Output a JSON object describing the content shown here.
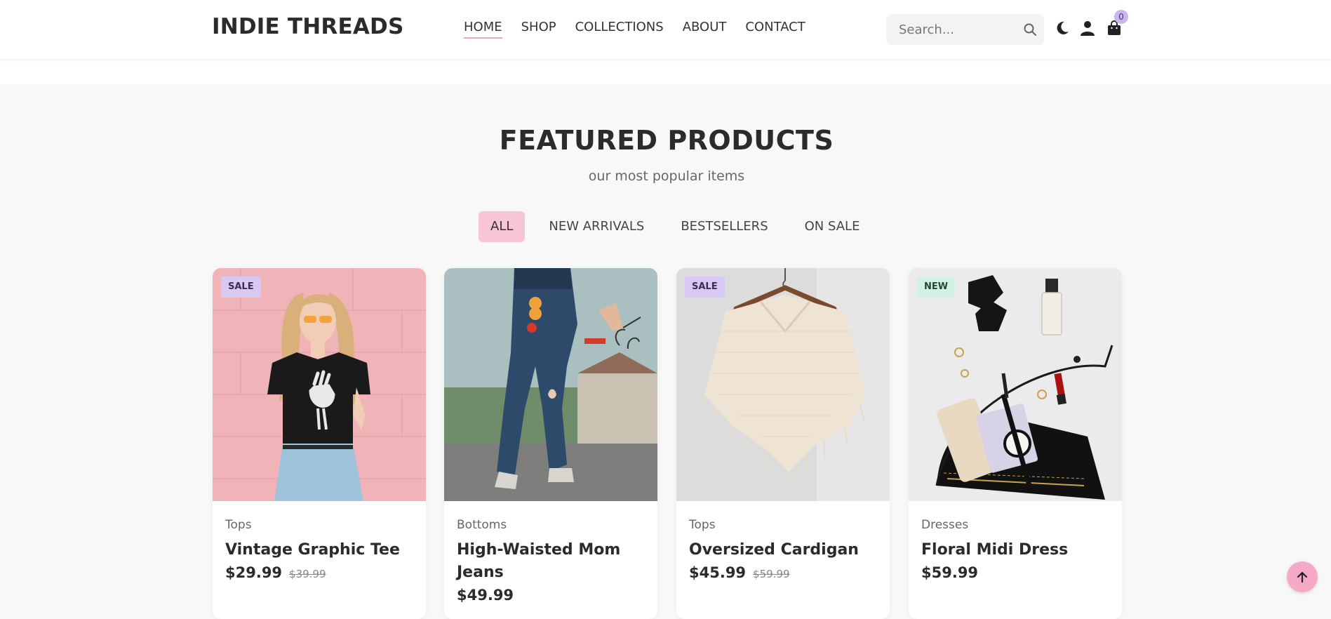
{
  "brand": {
    "name": "INDIE THREADS"
  },
  "nav": {
    "items": [
      {
        "label": "HOME",
        "active": true
      },
      {
        "label": "SHOP",
        "active": false
      },
      {
        "label": "COLLECTIONS",
        "active": false
      },
      {
        "label": "ABOUT",
        "active": false
      },
      {
        "label": "CONTACT",
        "active": false
      }
    ]
  },
  "search": {
    "placeholder": "Search...",
    "value": "",
    "icon": "search-icon"
  },
  "header_icons": {
    "theme": "moon-icon",
    "account": "user-icon",
    "cart": "shopping-bag-icon"
  },
  "cart": {
    "count": "0"
  },
  "section": {
    "title": "FEATURED PRODUCTS",
    "subtitle": "our most popular items"
  },
  "filters": [
    {
      "label": "ALL",
      "active": true
    },
    {
      "label": "NEW ARRIVALS",
      "active": false
    },
    {
      "label": "BESTSELLERS",
      "active": false
    },
    {
      "label": "ON SALE",
      "active": false
    }
  ],
  "products": [
    {
      "badge": "SALE",
      "category": "Tops",
      "title": "Vintage Graphic Tee",
      "price": "$29.99",
      "old_price": "$39.99"
    },
    {
      "badge": "",
      "category": "Bottoms",
      "title": "High-Waisted Mom Jeans",
      "price": "$49.99",
      "old_price": ""
    },
    {
      "badge": "SALE",
      "category": "Tops",
      "title": "Oversized Cardigan",
      "price": "$45.99",
      "old_price": "$59.99"
    },
    {
      "badge": "NEW",
      "category": "Dresses",
      "title": "Floral Midi Dress",
      "price": "$59.99",
      "old_price": ""
    }
  ],
  "scroll_to_top": {
    "icon": "arrow-up-icon"
  },
  "colors": {
    "accent_pink": "#f7c4d8",
    "sale_badge": "#d8c8f4",
    "new_badge": "#d3f2e3",
    "text_dark": "#2b2b2b"
  }
}
